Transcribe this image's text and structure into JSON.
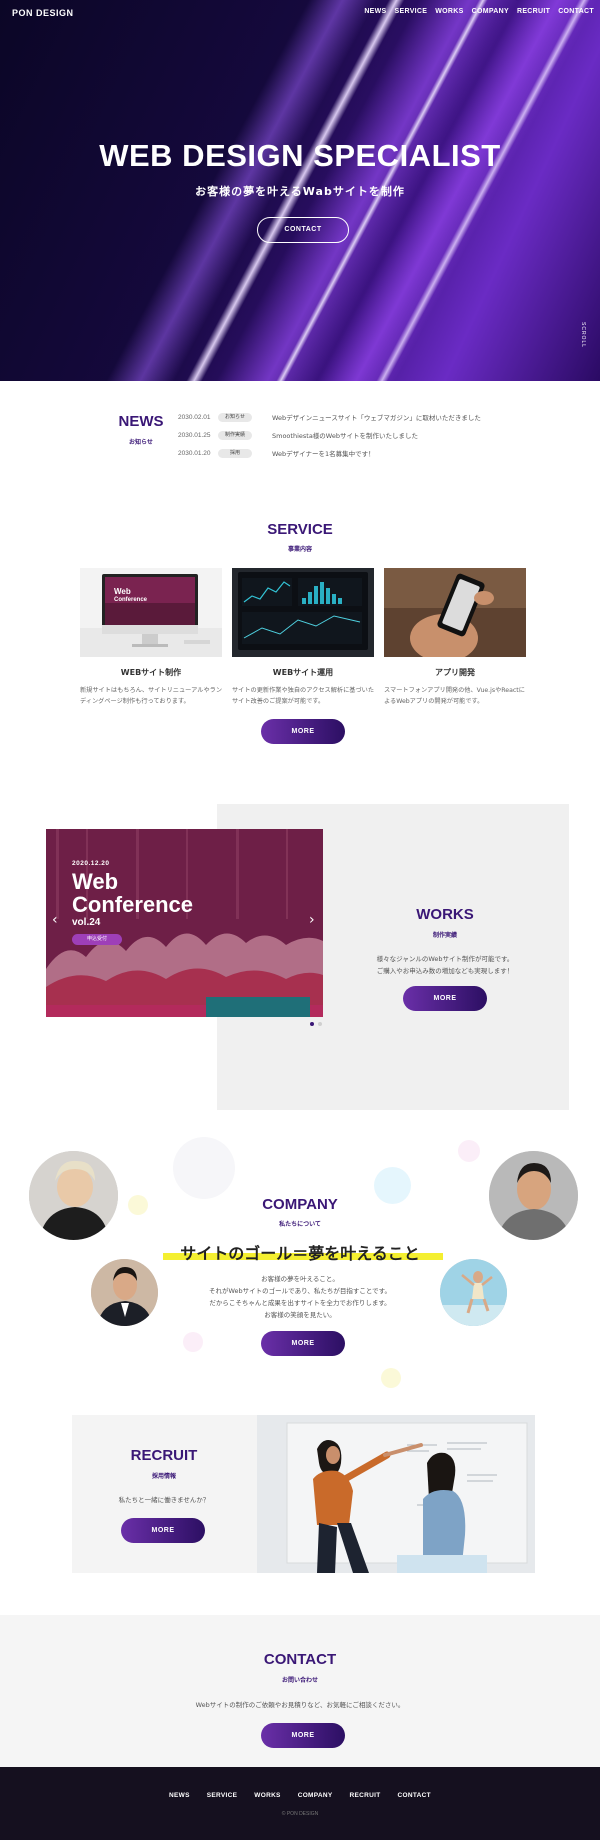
{
  "header": {
    "logo": "PON DESIGN",
    "nav": [
      "NEWS",
      "SERVICE",
      "WORKS",
      "COMPANY",
      "RECRUIT",
      "CONTACT"
    ]
  },
  "hero": {
    "title": "WEB DESIGN SPECIALIST",
    "subtitle": "お客様の夢を叶えるWabサイトを制作",
    "button": "CONTACT",
    "scroll": "SCROLL"
  },
  "news": {
    "title": "NEWS",
    "subtitle": "お知らせ",
    "items": [
      {
        "date": "2030.02.01",
        "category": "お知らせ",
        "text": "Webデザインニュースサイト「ウェブマガジン」に取材いただきました"
      },
      {
        "date": "2030.01.25",
        "category": "制作実績",
        "text": "Smoothiesta様のWebサイトを制作いたしました"
      },
      {
        "date": "2030.01.20",
        "category": "採用",
        "text": "Webデザイナーを1名募集中です！"
      }
    ]
  },
  "service": {
    "title": "SERVICE",
    "subtitle": "事業内容",
    "items": [
      {
        "name": "WEBサイト制作",
        "desc": "新規サイトはもちろん、サイトリニューアルやランディングページ制作も行っております。"
      },
      {
        "name": "WEBサイト運用",
        "desc": "サイトの更新作業や独自のアクセス解析に基づいたサイト改善のご提案が可能です。"
      },
      {
        "name": "アプリ開発",
        "desc": "スマートフォンアプリ開発の他、Vue.jsやReactによるWebアプリの開発が可能です。"
      }
    ],
    "button": "MORE"
  },
  "works": {
    "title": "WORKS",
    "subtitle": "制作実績",
    "text_lines": [
      "様々なジャンルのWebサイト制作が可能です。",
      "ご購入やお申込み数の増加なども実現します！"
    ],
    "button": "MORE",
    "slide": {
      "date": "2020.12.20",
      "heading_1": "Web",
      "heading_2": "Conference",
      "vol": "vol.24",
      "tag": "申込受付"
    }
  },
  "company": {
    "title": "COMPANY",
    "subtitle": "私たちについて",
    "lead": "サイトのゴール＝夢を叶えること",
    "text_lines": [
      "お客様の夢を叶えること。",
      "それがWebサイトのゴールであり、私たちが目指すことです。",
      "だからこそちゃんと成果を出すサイトを全力でお作りします。",
      "お客様の笑顔を見たい。"
    ],
    "button": "MORE"
  },
  "recruit": {
    "title": "RECRUIT",
    "subtitle": "採用情報",
    "text": "私たちと一緒に働きませんか？",
    "button": "MORE"
  },
  "contact": {
    "title": "CONTACT",
    "subtitle": "お問い合わせ",
    "text": "Webサイトの制作のご依頼やお見積りなど、お気軽にご相談ください。",
    "button": "MORE"
  },
  "footer": {
    "nav": [
      "NEWS",
      "SERVICE",
      "WORKS",
      "COMPANY",
      "RECRUIT",
      "CONTACT"
    ],
    "copyright": "© PON DESIGN"
  },
  "colors": {
    "accent": "#3a1776",
    "button_start": "#6a2fa8",
    "button_end": "#2c0f63",
    "highlight": "#f4ef30",
    "footer": "#15101f"
  }
}
